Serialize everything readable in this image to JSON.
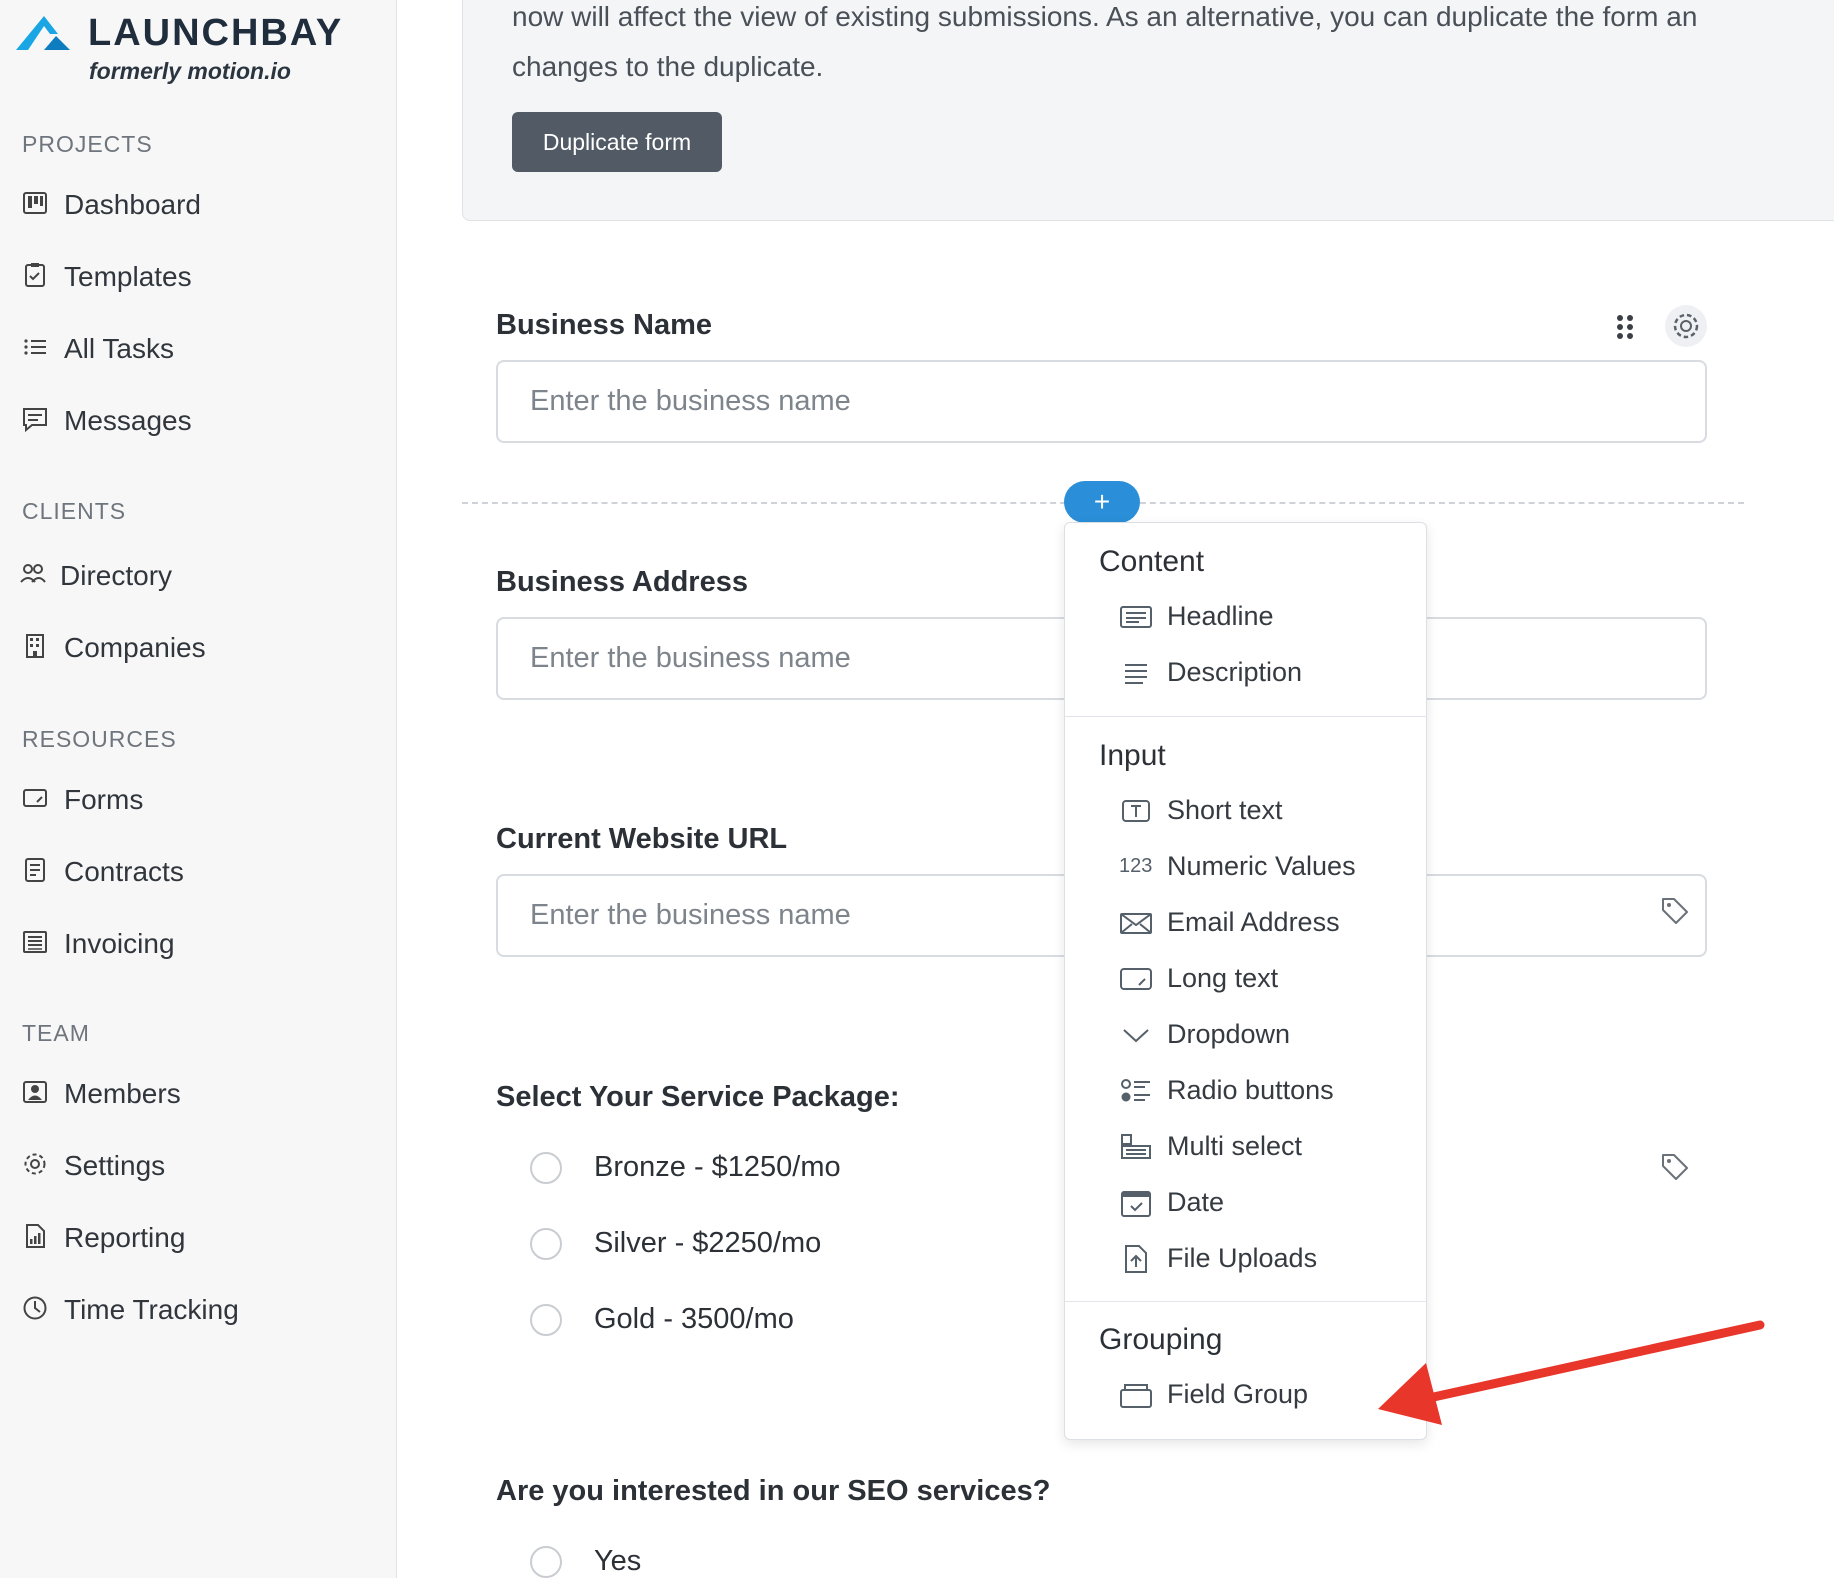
{
  "brand": {
    "name": "LAUNCHBAY",
    "tagline": "formerly motion.io",
    "accent_color": "#1aa6e4"
  },
  "sidebar": {
    "sections": [
      {
        "label": "PROJECTS",
        "items": [
          {
            "label": "Dashboard",
            "icon": "dashboard-icon"
          },
          {
            "label": "Templates",
            "icon": "clipboard-icon"
          },
          {
            "label": "All Tasks",
            "icon": "list-icon"
          },
          {
            "label": "Messages",
            "icon": "message-icon"
          }
        ]
      },
      {
        "label": "CLIENTS",
        "items": [
          {
            "label": "Directory",
            "icon": "people-icon"
          },
          {
            "label": "Companies",
            "icon": "building-icon"
          }
        ]
      },
      {
        "label": "RESOURCES",
        "items": [
          {
            "label": "Forms",
            "icon": "form-icon"
          },
          {
            "label": "Contracts",
            "icon": "document-icon"
          },
          {
            "label": "Invoicing",
            "icon": "invoice-icon"
          }
        ]
      },
      {
        "label": "TEAM",
        "items": [
          {
            "label": "Members",
            "icon": "member-icon"
          },
          {
            "label": "Settings",
            "icon": "gear-icon"
          },
          {
            "label": "Reporting",
            "icon": "report-icon"
          },
          {
            "label": "Time Tracking",
            "icon": "clock-icon"
          }
        ]
      }
    ]
  },
  "notice": {
    "line1": "now will affect the view of existing submissions. As an alternative, you can duplicate the form an",
    "line2": "changes to the duplicate.",
    "button": "Duplicate form"
  },
  "form": {
    "fields": [
      {
        "label": "Business Name",
        "placeholder": "Enter the business name"
      },
      {
        "label": "Business Address",
        "placeholder": "Enter the business name"
      },
      {
        "label": "Current Website URL",
        "placeholder": "Enter the business name"
      }
    ],
    "service_package": {
      "label": "Select Your Service Package:",
      "options": [
        "Bronze - $1250/mo",
        "Silver - $2250/mo",
        "Gold - 3500/mo"
      ]
    },
    "seo": {
      "label": "Are you interested in our SEO services?",
      "options": [
        "Yes"
      ]
    },
    "add_button": "+"
  },
  "menu": {
    "groups": [
      {
        "heading": "Content",
        "items": [
          {
            "label": "Headline",
            "icon": "headline-icon"
          },
          {
            "label": "Description",
            "icon": "description-icon"
          }
        ]
      },
      {
        "heading": "Input",
        "items": [
          {
            "label": "Short text",
            "icon": "short-text-icon"
          },
          {
            "label": "Numeric Values",
            "icon": "numeric-icon",
            "icon_text": "123"
          },
          {
            "label": "Email Address",
            "icon": "email-icon"
          },
          {
            "label": "Long text",
            "icon": "long-text-icon"
          },
          {
            "label": "Dropdown",
            "icon": "chevron-down-icon"
          },
          {
            "label": "Radio buttons",
            "icon": "radio-list-icon"
          },
          {
            "label": "Multi select",
            "icon": "multi-select-icon"
          },
          {
            "label": "Date",
            "icon": "calendar-icon"
          },
          {
            "label": "File Uploads",
            "icon": "file-upload-icon"
          }
        ]
      },
      {
        "heading": "Grouping",
        "items": [
          {
            "label": "Field Group",
            "icon": "field-group-icon"
          }
        ]
      }
    ]
  },
  "annotation": {
    "arrow_color": "#e8362b"
  }
}
